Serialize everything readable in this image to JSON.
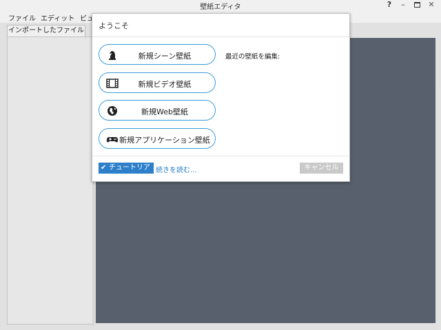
{
  "window": {
    "title": "壁紙エディタ",
    "help_label": "?",
    "minimize_label": "–",
    "close_label": "✕"
  },
  "menubar": {
    "items": [
      "ファイル",
      "エディット",
      "ビュ"
    ]
  },
  "left_panel": {
    "tab_label": "インポートしたファイル"
  },
  "dialog": {
    "title": "ようこそ",
    "options": [
      {
        "label": "新規シーン壁紙",
        "icon": "chess-knight-icon"
      },
      {
        "label": "新規ビデオ壁紙",
        "icon": "film-icon"
      },
      {
        "label": "新規Web壁紙",
        "icon": "globe-icon"
      },
      {
        "label": "新規アプリケーション壁紙",
        "icon": "gamepad-icon"
      }
    ],
    "recent_label": "最近の壁紙を編集:",
    "tutorial_label": "チュートリアル",
    "read_more_label": "続きを読む...",
    "cancel_label": "キャンセル"
  },
  "colors": {
    "accent": "#2c7fc8",
    "button_border": "#3a9ad9",
    "preview_bg": "#5d6773",
    "cancel_bg": "#c9c9c9"
  }
}
